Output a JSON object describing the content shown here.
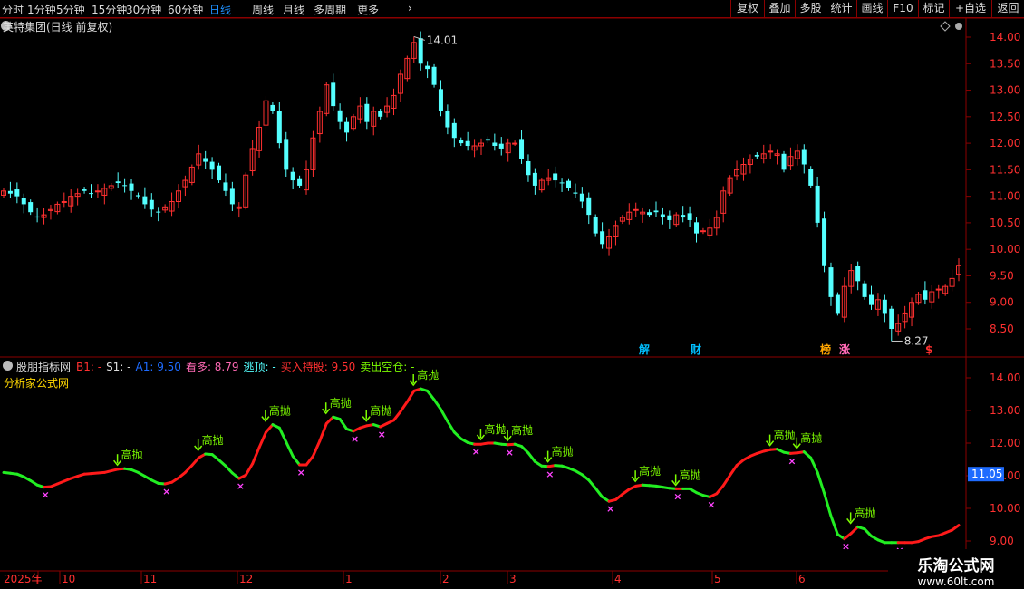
{
  "toolbar": {
    "periods": [
      "分时",
      "1分钟",
      "5分钟",
      "15分钟",
      "30分钟",
      "60分钟",
      "日线",
      "周线",
      "月线",
      "多周期",
      "更多"
    ],
    "active_period": "日线",
    "more_icon": "chevron-right-icon",
    "right_buttons": [
      "复权",
      "叠加",
      "多股",
      "统计",
      "画线",
      "F10",
      "标记",
      "+自选",
      "返回"
    ]
  },
  "main_panel": {
    "title": "英特集团(日线 前复权)",
    "dropdown_icon": "chevron-down-circle-icon",
    "diamond_icon": "diamond-icon",
    "y_ticks": [
      "14.00",
      "13.50",
      "13.00",
      "12.50",
      "12.00",
      "11.50",
      "11.00",
      "10.50",
      "10.00",
      "9.50",
      "9.00",
      "8.50"
    ],
    "high_label": "14.01",
    "low_label": "8.27",
    "event_marks": [
      {
        "text": "解",
        "color": "#00bfff"
      },
      {
        "text": "财",
        "color": "#00bfff"
      },
      {
        "text": "榜",
        "color": "#ffa500"
      },
      {
        "text": "涨",
        "color": "#ff69b4"
      },
      {
        "text": "$",
        "color": "#ff3030"
      }
    ],
    "colors": {
      "up": "#ff3030",
      "down": "#54ffff",
      "border": "#8b0000"
    }
  },
  "indicator_panel": {
    "name": "股朋指标网",
    "dropdown_icon": "chevron-down-circle-icon",
    "fields": [
      {
        "label": "B1:",
        "value": "-",
        "color": "#ff3030"
      },
      {
        "label": "S1:",
        "value": "-",
        "color": "#dddddd"
      },
      {
        "label": "A1:",
        "value": "9.50",
        "color": "#1e6bff"
      },
      {
        "label": "看多:",
        "value": "8.79",
        "color": "#ff69b4"
      },
      {
        "label": "逃顶:",
        "value": "-",
        "color": "#54ffff"
      },
      {
        "label": "买入持股:",
        "value": "9.50",
        "color": "#ff3030"
      },
      {
        "label": "卖出空仓:",
        "value": "-",
        "color": "#7cfc00"
      }
    ],
    "subtitle": "分析家公式网",
    "y_ticks": [
      "14.00",
      "13.00",
      "12.00",
      "11.00",
      "10.00",
      "9.00"
    ],
    "current_value": "11.05",
    "signal_label": "高抛",
    "colors": {
      "up_line": "#ff1a1a",
      "down_line": "#22ee22",
      "signal": "#7cfc00",
      "cross": "#ff44ff",
      "current_box": "#1e6bff"
    }
  },
  "x_axis": {
    "labels": [
      "2025年",
      "10",
      "11",
      "12",
      "1",
      "2",
      "3",
      "4",
      "5",
      "6"
    ]
  },
  "watermark": {
    "line1": "乐淘公式网",
    "line2": "www.60lt.com"
  },
  "chart_data": {
    "type": "candlestick",
    "price_range": [
      8.1,
      14.3
    ],
    "indicator_range": [
      8.9,
      14.4
    ],
    "high": 14.01,
    "low": 8.27,
    "closes": [
      11.1,
      11.05,
      11.0,
      10.85,
      10.7,
      10.6,
      10.65,
      10.75,
      10.85,
      10.9,
      11.0,
      11.05,
      11.1,
      11.05,
      11.1,
      11.15,
      11.2,
      11.25,
      11.2,
      11.1,
      11.0,
      10.85,
      10.75,
      10.7,
      10.8,
      10.9,
      11.1,
      11.3,
      11.55,
      11.8,
      11.65,
      11.5,
      11.3,
      11.1,
      10.85,
      10.8,
      11.4,
      11.9,
      12.3,
      12.8,
      12.6,
      12.0,
      11.5,
      11.3,
      11.2,
      11.5,
      12.1,
      12.6,
      13.1,
      12.7,
      12.4,
      12.2,
      12.5,
      12.7,
      12.4,
      12.6,
      12.5,
      12.7,
      12.9,
      13.3,
      13.6,
      13.9,
      13.5,
      13.4,
      13.1,
      12.6,
      12.3,
      12.1,
      12.0,
      11.95,
      11.95,
      12.0,
      12.05,
      11.95,
      11.9,
      12.0,
      12.0,
      11.7,
      11.4,
      11.2,
      11.3,
      11.35,
      11.3,
      11.25,
      11.15,
      11.05,
      10.9,
      10.65,
      10.3,
      10.1,
      10.25,
      10.45,
      10.6,
      10.7,
      10.75,
      10.7,
      10.65,
      10.7,
      10.6,
      10.55,
      10.65,
      10.6,
      10.55,
      10.3,
      10.35,
      10.4,
      10.6,
      11.1,
      11.35,
      11.5,
      11.6,
      11.7,
      11.75,
      11.8,
      11.85,
      11.8,
      11.5,
      11.75,
      11.85,
      11.6,
      11.2,
      10.5,
      9.7,
      9.1,
      8.8,
      9.3,
      9.6,
      9.4,
      9.1,
      8.95,
      9.05,
      8.8,
      8.5,
      8.6,
      8.8,
      9.0,
      9.15,
      9.05,
      9.2,
      9.25,
      9.3,
      9.45,
      9.7
    ]
  }
}
